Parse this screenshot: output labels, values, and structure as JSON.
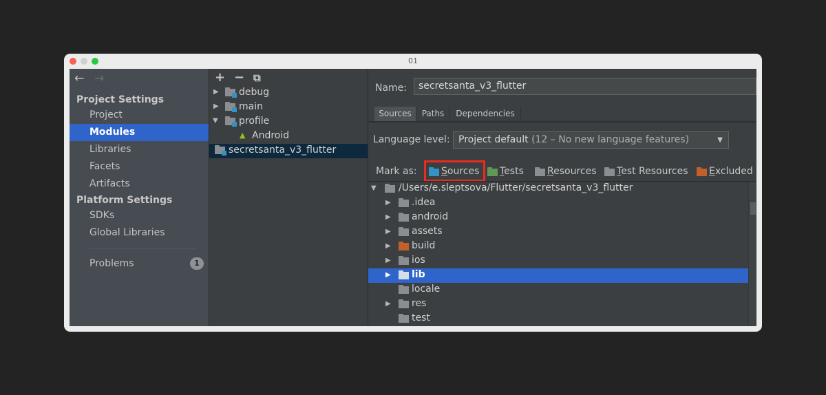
{
  "window": {
    "title": "01"
  },
  "sidebar": {
    "sections": [
      {
        "title": "Project Settings",
        "items": [
          "Project",
          "Modules",
          "Libraries",
          "Facets",
          "Artifacts"
        ]
      },
      {
        "title": "Platform Settings",
        "items": [
          "SDKs",
          "Global Libraries"
        ]
      }
    ],
    "selected": "Modules",
    "problems": {
      "label": "Problems",
      "count": "1"
    }
  },
  "modules_toolbar": {
    "add": "+",
    "remove": "−",
    "copy": "⧉"
  },
  "modules_tree": [
    {
      "label": "debug",
      "expanded": false
    },
    {
      "label": "main",
      "expanded": false
    },
    {
      "label": "profile",
      "expanded": true
    },
    {
      "label": "Android"
    },
    {
      "label": "secretsanta_v3_flutter",
      "selected": true
    }
  ],
  "module_name": {
    "label": "Name:",
    "value": "secretsanta_v3_flutter"
  },
  "tabs": [
    "Sources",
    "Paths",
    "Dependencies"
  ],
  "active_tab": "Sources",
  "language_level": {
    "label": "Language level:",
    "value": "Project default",
    "detail": "(12 – No new language features)"
  },
  "mark_as": {
    "label": "Mark as:",
    "options": [
      "Sources",
      "Tests",
      "Resources",
      "Test Resources",
      "Excluded"
    ]
  },
  "content_tree": {
    "root": "/Users/e.sleptsova/Flutter/secretsanta_v3_flutter",
    "children": [
      ".idea",
      "android",
      "assets",
      "build",
      "ios",
      "lib",
      "locale",
      "res",
      "test"
    ],
    "selected": "lib"
  },
  "colors": {
    "selection": "#2f65ca",
    "sources_folder": "#3592c4",
    "tests_folder": "#629755",
    "resources_folder": "#8a8e93",
    "excluded_folder": "#c35f2a",
    "highlight_box": "#f0291d"
  }
}
